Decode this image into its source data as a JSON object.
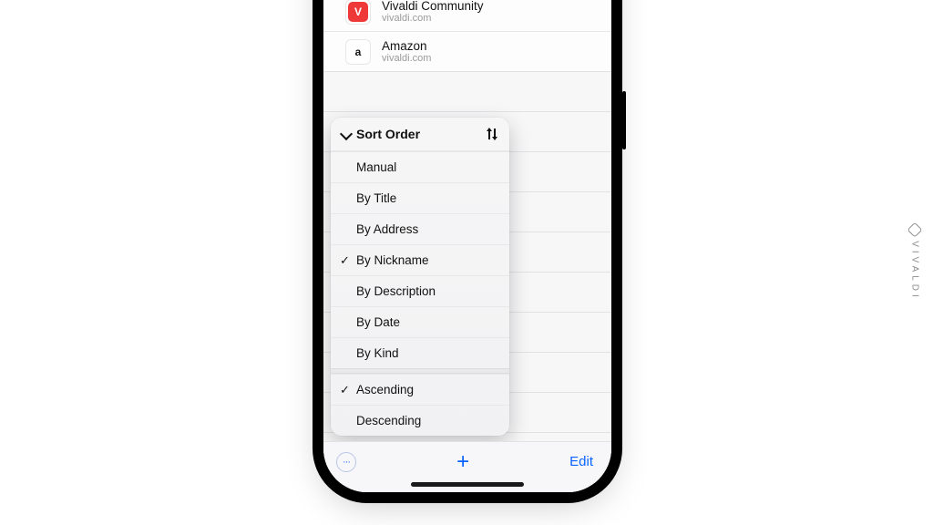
{
  "watermark": "VIVALDI",
  "bookmarks": [
    {
      "icon": "vivaldi-icon",
      "icon_glyph": "V",
      "title": "Vivaldi Community",
      "subtitle": "vivaldi.com"
    },
    {
      "icon": "amazon-icon",
      "icon_glyph": "a",
      "title": "Amazon",
      "subtitle": "vivaldi.com"
    }
  ],
  "popup": {
    "header": "Sort Order",
    "sort_icon": "sort-arrows-icon",
    "options": [
      {
        "label": "Manual",
        "checked": false
      },
      {
        "label": "By Title",
        "checked": false
      },
      {
        "label": "By Address",
        "checked": false
      },
      {
        "label": "By Nickname",
        "checked": true
      },
      {
        "label": "By Description",
        "checked": false
      },
      {
        "label": "By Date",
        "checked": false
      },
      {
        "label": "By Kind",
        "checked": false
      }
    ],
    "direction": [
      {
        "label": "Ascending",
        "checked": true
      },
      {
        "label": "Descending",
        "checked": false
      }
    ]
  },
  "toolbar": {
    "more_glyph": "···",
    "add_glyph": "+",
    "edit_label": "Edit"
  }
}
